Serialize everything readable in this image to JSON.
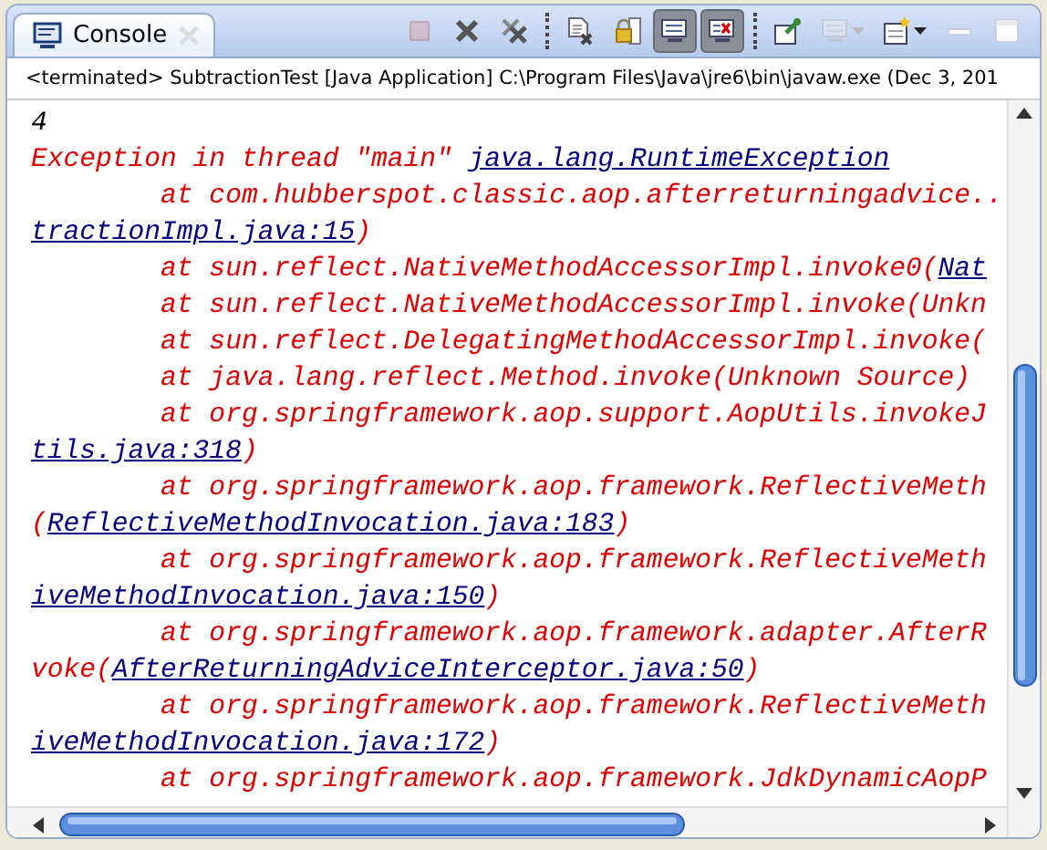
{
  "view": {
    "tab": {
      "title": "Console",
      "selected": true
    },
    "toolbar": [
      {
        "kind": "terminate",
        "disabled": true,
        "pressed": false
      },
      {
        "kind": "remove",
        "disabled": false,
        "pressed": false
      },
      {
        "kind": "remove-all",
        "disabled": false,
        "pressed": false
      },
      {
        "kind": "separator"
      },
      {
        "kind": "clear",
        "disabled": false,
        "pressed": false
      },
      {
        "kind": "scroll-lock",
        "disabled": false,
        "pressed": false
      },
      {
        "kind": "show-stdout",
        "disabled": false,
        "pressed": true
      },
      {
        "kind": "show-stderr",
        "disabled": false,
        "pressed": true
      },
      {
        "kind": "separator"
      },
      {
        "kind": "pin",
        "disabled": false,
        "pressed": false
      },
      {
        "kind": "display-console",
        "disabled": true,
        "pressed": false,
        "dropdown": true
      },
      {
        "kind": "open-console",
        "disabled": false,
        "pressed": false,
        "dropdown": true
      },
      {
        "kind": "minimize",
        "disabled": false,
        "pressed": false
      },
      {
        "kind": "maximize",
        "disabled": false,
        "pressed": false
      }
    ]
  },
  "status": "<terminated> SubtractionTest [Java Application] C:\\Program Files\\Java\\jre6\\bin\\javaw.exe (Dec 3, 201",
  "console": {
    "lines": [
      {
        "color": "#000000",
        "parts": [
          {
            "text": "4",
            "link": false
          }
        ]
      },
      {
        "color": "#e00000",
        "parts": [
          {
            "text": "Exception in thread \"main\" ",
            "link": false
          },
          {
            "text": "java.lang.RuntimeException",
            "link": true
          }
        ]
      },
      {
        "color": "#e00000",
        "parts": [
          {
            "text": "\tat com.hubberspot.classic.aop.afterreturningadvice..",
            "link": false
          }
        ]
      },
      {
        "color": "#e00000",
        "parts": [
          {
            "text": "tractionImpl.java:15",
            "link": true
          },
          {
            "text": ")",
            "link": false
          }
        ]
      },
      {
        "color": "#e00000",
        "parts": [
          {
            "text": "\tat sun.reflect.NativeMethodAccessorImpl.invoke0(",
            "link": false
          },
          {
            "text": "Nat",
            "link": true
          }
        ]
      },
      {
        "color": "#e00000",
        "parts": [
          {
            "text": "\tat sun.reflect.NativeMethodAccessorImpl.invoke(Unkn",
            "link": false
          }
        ]
      },
      {
        "color": "#e00000",
        "parts": [
          {
            "text": "\tat sun.reflect.DelegatingMethodAccessorImpl.invoke(",
            "link": false
          }
        ]
      },
      {
        "color": "#e00000",
        "parts": [
          {
            "text": "\tat java.lang.reflect.Method.invoke(Unknown Source)",
            "link": false
          }
        ]
      },
      {
        "color": "#e00000",
        "parts": [
          {
            "text": "\tat org.springframework.aop.support.AopUtils.invokeJ",
            "link": false
          }
        ]
      },
      {
        "color": "#e00000",
        "parts": [
          {
            "text": "tils.java:318",
            "link": true
          },
          {
            "text": ")",
            "link": false
          }
        ]
      },
      {
        "color": "#e00000",
        "parts": [
          {
            "text": "\tat org.springframework.aop.framework.ReflectiveMeth",
            "link": false
          }
        ]
      },
      {
        "color": "#e00000",
        "parts": [
          {
            "text": "(",
            "link": false
          },
          {
            "text": "ReflectiveMethodInvocation.java:183",
            "link": true
          },
          {
            "text": ")",
            "link": false
          }
        ]
      },
      {
        "color": "#e00000",
        "parts": [
          {
            "text": "\tat org.springframework.aop.framework.ReflectiveMeth",
            "link": false
          }
        ]
      },
      {
        "color": "#e00000",
        "parts": [
          {
            "text": "iveMethodInvocation.java:150",
            "link": true
          },
          {
            "text": ")",
            "link": false
          }
        ]
      },
      {
        "color": "#e00000",
        "parts": [
          {
            "text": "\tat org.springframework.aop.framework.adapter.AfterR",
            "link": false
          }
        ]
      },
      {
        "color": "#e00000",
        "parts": [
          {
            "text": "voke(",
            "link": false
          },
          {
            "text": "AfterReturningAdviceInterceptor.java:50",
            "link": true
          },
          {
            "text": ")",
            "link": false
          }
        ]
      },
      {
        "color": "#e00000",
        "parts": [
          {
            "text": "\tat org.springframework.aop.framework.ReflectiveMeth",
            "link": false
          }
        ]
      },
      {
        "color": "#e00000",
        "parts": [
          {
            "text": "iveMethodInvocation.java:172",
            "link": true
          },
          {
            "text": ")",
            "link": false
          }
        ]
      },
      {
        "color": "#e00000",
        "parts": [
          {
            "text": "\tat org.springframework.aop.framework.JdkDynamicAopP",
            "link": false
          }
        ]
      }
    ]
  }
}
